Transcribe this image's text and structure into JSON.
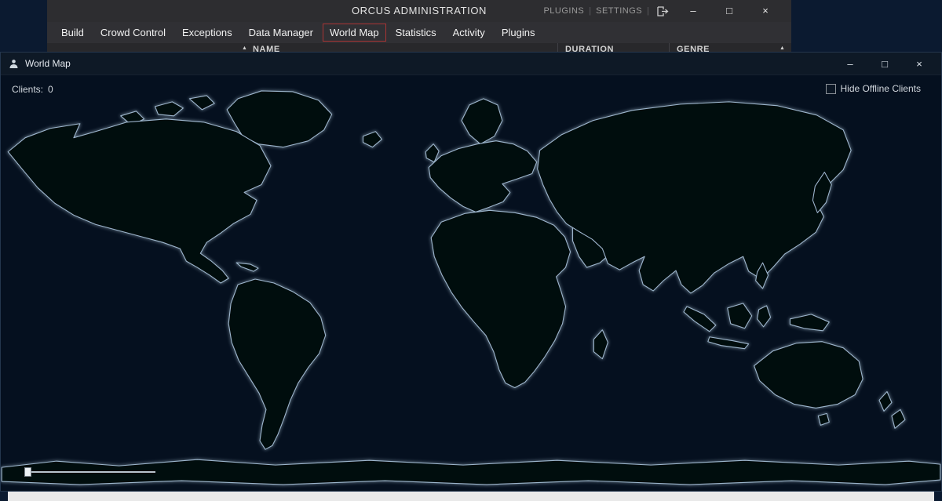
{
  "main_window": {
    "title": "ORCUS ADMINISTRATION",
    "links": {
      "plugins": "PLUGINS",
      "settings": "SETTINGS",
      "divider": "|"
    },
    "window_buttons": {
      "minimize": "–",
      "maximize": "□",
      "close": "×"
    },
    "menu_items": [
      "Build",
      "Crowd Control",
      "Exceptions",
      "Data Manager",
      "World Map",
      "Statistics",
      "Activity",
      "Plugins"
    ],
    "active_menu_item": "World Map",
    "table_headers": {
      "name": "NAME",
      "duration": "DURATION",
      "genre": "GENRE"
    },
    "sort_icon": "▲"
  },
  "map_window": {
    "title": "World Map",
    "window_buttons": {
      "minimize": "–",
      "maximize": "□",
      "close": "×"
    },
    "clients_label": "Clients:",
    "clients_count": "0",
    "hide_offline_checkbox": {
      "label": "Hide Offline Clients",
      "checked": false
    },
    "zoom_slider": {
      "position": "min"
    }
  },
  "icons": {
    "logout": "door-with-arrow",
    "map_window_app": "user-silhouette",
    "sort": "triangle-up",
    "checkbox": "unchecked-square"
  },
  "colors": {
    "desktop_bg": "#0b1a30",
    "main_window_bg": "#2d2d30",
    "map_bg": "#05101f",
    "active_menu_border": "#a83434",
    "coastline": "#9db6cc",
    "landmass": "#01070f"
  }
}
